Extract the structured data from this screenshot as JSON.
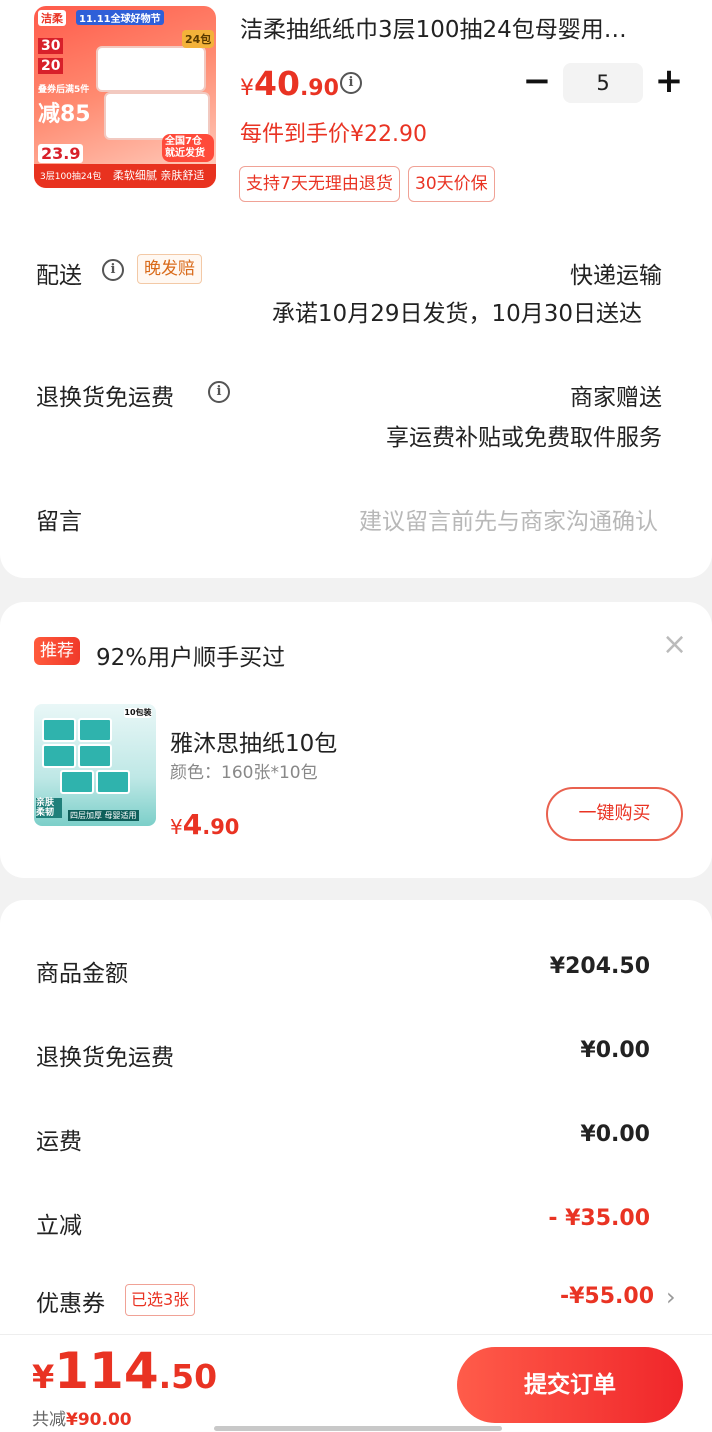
{
  "product": {
    "title": "洁柔抽纸纸巾3层100抽24包母婴用…",
    "price_currency": "¥",
    "price_int": "40",
    "price_dec": ".90",
    "quantity": "5",
    "each_price": "每件到手价¥22.90",
    "badges": [
      "支持7天无理由退货",
      "30天价保"
    ],
    "thumb": {
      "brand": "洁柔",
      "event": "11.11全球好物节",
      "promo_a": "30",
      "promo_b": "20",
      "discount": "减85",
      "coupon_label": "叠券后满5件",
      "low_price": "23.9",
      "pack": "24包",
      "bottom_left": "3层100抽24包",
      "bottom_right": "柔软细腻 亲肤舒适",
      "nationwide": "全国7仓就近发货"
    }
  },
  "shipping": {
    "label": "配送",
    "tag": "晚发赔",
    "method": "快递运输",
    "promise": "承诺10月29日发货，10月30日送达"
  },
  "return_shipping": {
    "label": "退换货免运费",
    "value": "商家赠送",
    "detail": "享运费补贴或免费取件服务"
  },
  "message": {
    "label": "留言",
    "placeholder": "建议留言前先与商家沟通确认"
  },
  "recommend": {
    "badge": "推荐",
    "title": "92%用户顺手买过",
    "close": "×",
    "name": "雅沐思抽纸10包",
    "spec": "颜色：160张*10包",
    "price_currency": "¥",
    "price_int": "4",
    "price_dec": ".90",
    "buy_label": "一键购买",
    "thumb_badge": "10包装",
    "thumb_text_left": "亲肤柔韧",
    "thumb_text_bottom": "四层加厚 母婴适用"
  },
  "summary": {
    "rows": [
      {
        "label": "商品金额",
        "value": "¥204.50"
      },
      {
        "label": "退换货免运费",
        "value": "¥0.00"
      },
      {
        "label": "运费",
        "value": "¥0.00"
      },
      {
        "label": "立减",
        "value": "- ¥35.00"
      },
      {
        "label": "优惠券",
        "value": "-¥55.00"
      }
    ],
    "coupon_tag": "已选3张"
  },
  "footer": {
    "total_currency": "¥",
    "total_int": "114",
    "total_dec": ".50",
    "saved_label": "共减",
    "saved_value": "¥90.00",
    "submit_label": "提交订单"
  },
  "colors": {
    "accent_red": "#e93323",
    "orange_tag": "#d96a1a"
  }
}
